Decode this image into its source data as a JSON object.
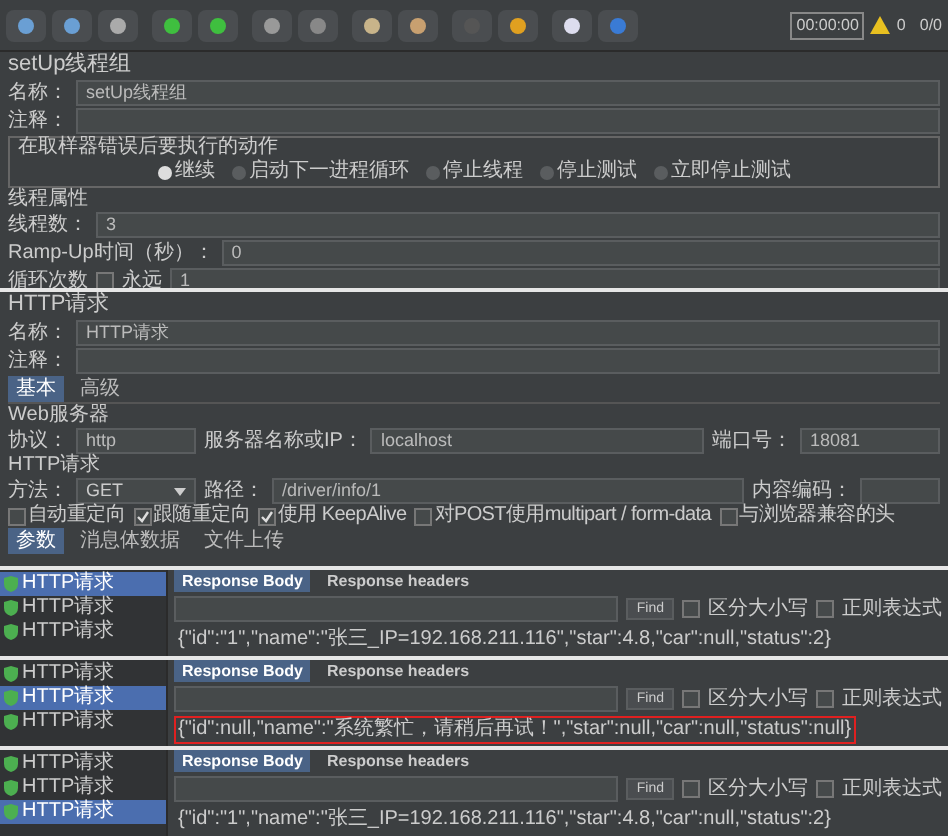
{
  "toolbar": {
    "timer": "00:00:00",
    "warnings": "0",
    "counter": "0/0"
  },
  "thread_group": {
    "title": "setUp线程组",
    "name_label": "名称：",
    "name": "setUp线程组",
    "comment_label": "注释：",
    "error_action": {
      "legend": "在取样器错误后要执行的动作",
      "options": [
        {
          "label": "继续",
          "selected": true
        },
        {
          "label": "启动下一进程循环",
          "selected": false
        },
        {
          "label": "停止线程",
          "selected": false
        },
        {
          "label": "停止测试",
          "selected": false
        },
        {
          "label": "立即停止测试",
          "selected": false
        }
      ]
    },
    "properties": {
      "title": "线程属性",
      "threads_label": "线程数：",
      "threads": "3",
      "rampup_label": "Ramp-Up时间（秒）：",
      "rampup": "0",
      "loop_label": "循环次数",
      "forever_label": "永远",
      "forever_checked": false,
      "loops": "1"
    }
  },
  "http_request": {
    "title": "HTTP请求",
    "name_label": "名称：",
    "name": "HTTP请求",
    "comment_label": "注释：",
    "tabs": [
      {
        "label": "基本",
        "selected": true
      },
      {
        "label": "高级",
        "selected": false
      }
    ],
    "web_server": {
      "title": "Web服务器",
      "protocol_label": "协议：",
      "protocol": "http",
      "server_label": "服务器名称或IP：",
      "server": "localhost",
      "port_label": "端口号：",
      "port": "18081"
    },
    "request": {
      "title": "HTTP请求",
      "method_label": "方法：",
      "method": "GET",
      "path_label": "路径：",
      "path": "/driver/info/1",
      "encoding_label": "内容编码："
    },
    "options": [
      {
        "label": "自动重定向",
        "checked": false
      },
      {
        "label": "跟随重定向",
        "checked": true
      },
      {
        "label": "使用 KeepAlive",
        "checked": true
      },
      {
        "label": "对POST使用multipart / form-data",
        "checked": false
      },
      {
        "label": "与浏览器兼容的头",
        "checked": false
      }
    ],
    "sub_tabs": [
      {
        "label": "参数",
        "selected": true
      },
      {
        "label": "消息体数据",
        "selected": false
      },
      {
        "label": "文件上传",
        "selected": false
      }
    ]
  },
  "results": [
    {
      "tree": [
        {
          "label": "HTTP请求",
          "selected": true
        },
        {
          "label": "HTTP请求",
          "selected": false
        },
        {
          "label": "HTTP请求",
          "selected": false
        }
      ],
      "tabs": [
        {
          "label": "Response Body",
          "selected": true
        },
        {
          "label": "Response headers",
          "selected": false
        }
      ],
      "find": "Find",
      "case_label": "区分大小写",
      "case_checked": false,
      "regex_label": "正则表达式",
      "regex_checked": false,
      "body": "{\"id\":\"1\",\"name\":\"张三_IP=192.168.211.116\",\"star\":4.8,\"car\":null,\"status\":2}",
      "highlighted": false
    },
    {
      "tree": [
        {
          "label": "HTTP请求",
          "selected": false
        },
        {
          "label": "HTTP请求",
          "selected": true
        },
        {
          "label": "HTTP请求",
          "selected": false
        }
      ],
      "tabs": [
        {
          "label": "Response Body",
          "selected": true
        },
        {
          "label": "Response headers",
          "selected": false
        }
      ],
      "find": "Find",
      "case_label": "区分大小写",
      "case_checked": false,
      "regex_label": "正则表达式",
      "regex_checked": false,
      "body": "{\"id\":null,\"name\":\"系统繁忙，请稍后再试！\",\"star\":null,\"car\":null,\"status\":null}",
      "highlighted": true
    },
    {
      "tree": [
        {
          "label": "HTTP请求",
          "selected": false
        },
        {
          "label": "HTTP请求",
          "selected": false
        },
        {
          "label": "HTTP请求",
          "selected": true
        }
      ],
      "tabs": [
        {
          "label": "Response Body",
          "selected": true
        },
        {
          "label": "Response headers",
          "selected": false
        }
      ],
      "find": "Find",
      "case_label": "区分大小写",
      "case_checked": false,
      "regex_label": "正则表达式",
      "regex_checked": false,
      "body": "{\"id\":\"1\",\"name\":\"张三_IP=192.168.211.116\",\"star\":4.8,\"car\":null,\"status\":2}",
      "highlighted": false
    }
  ]
}
